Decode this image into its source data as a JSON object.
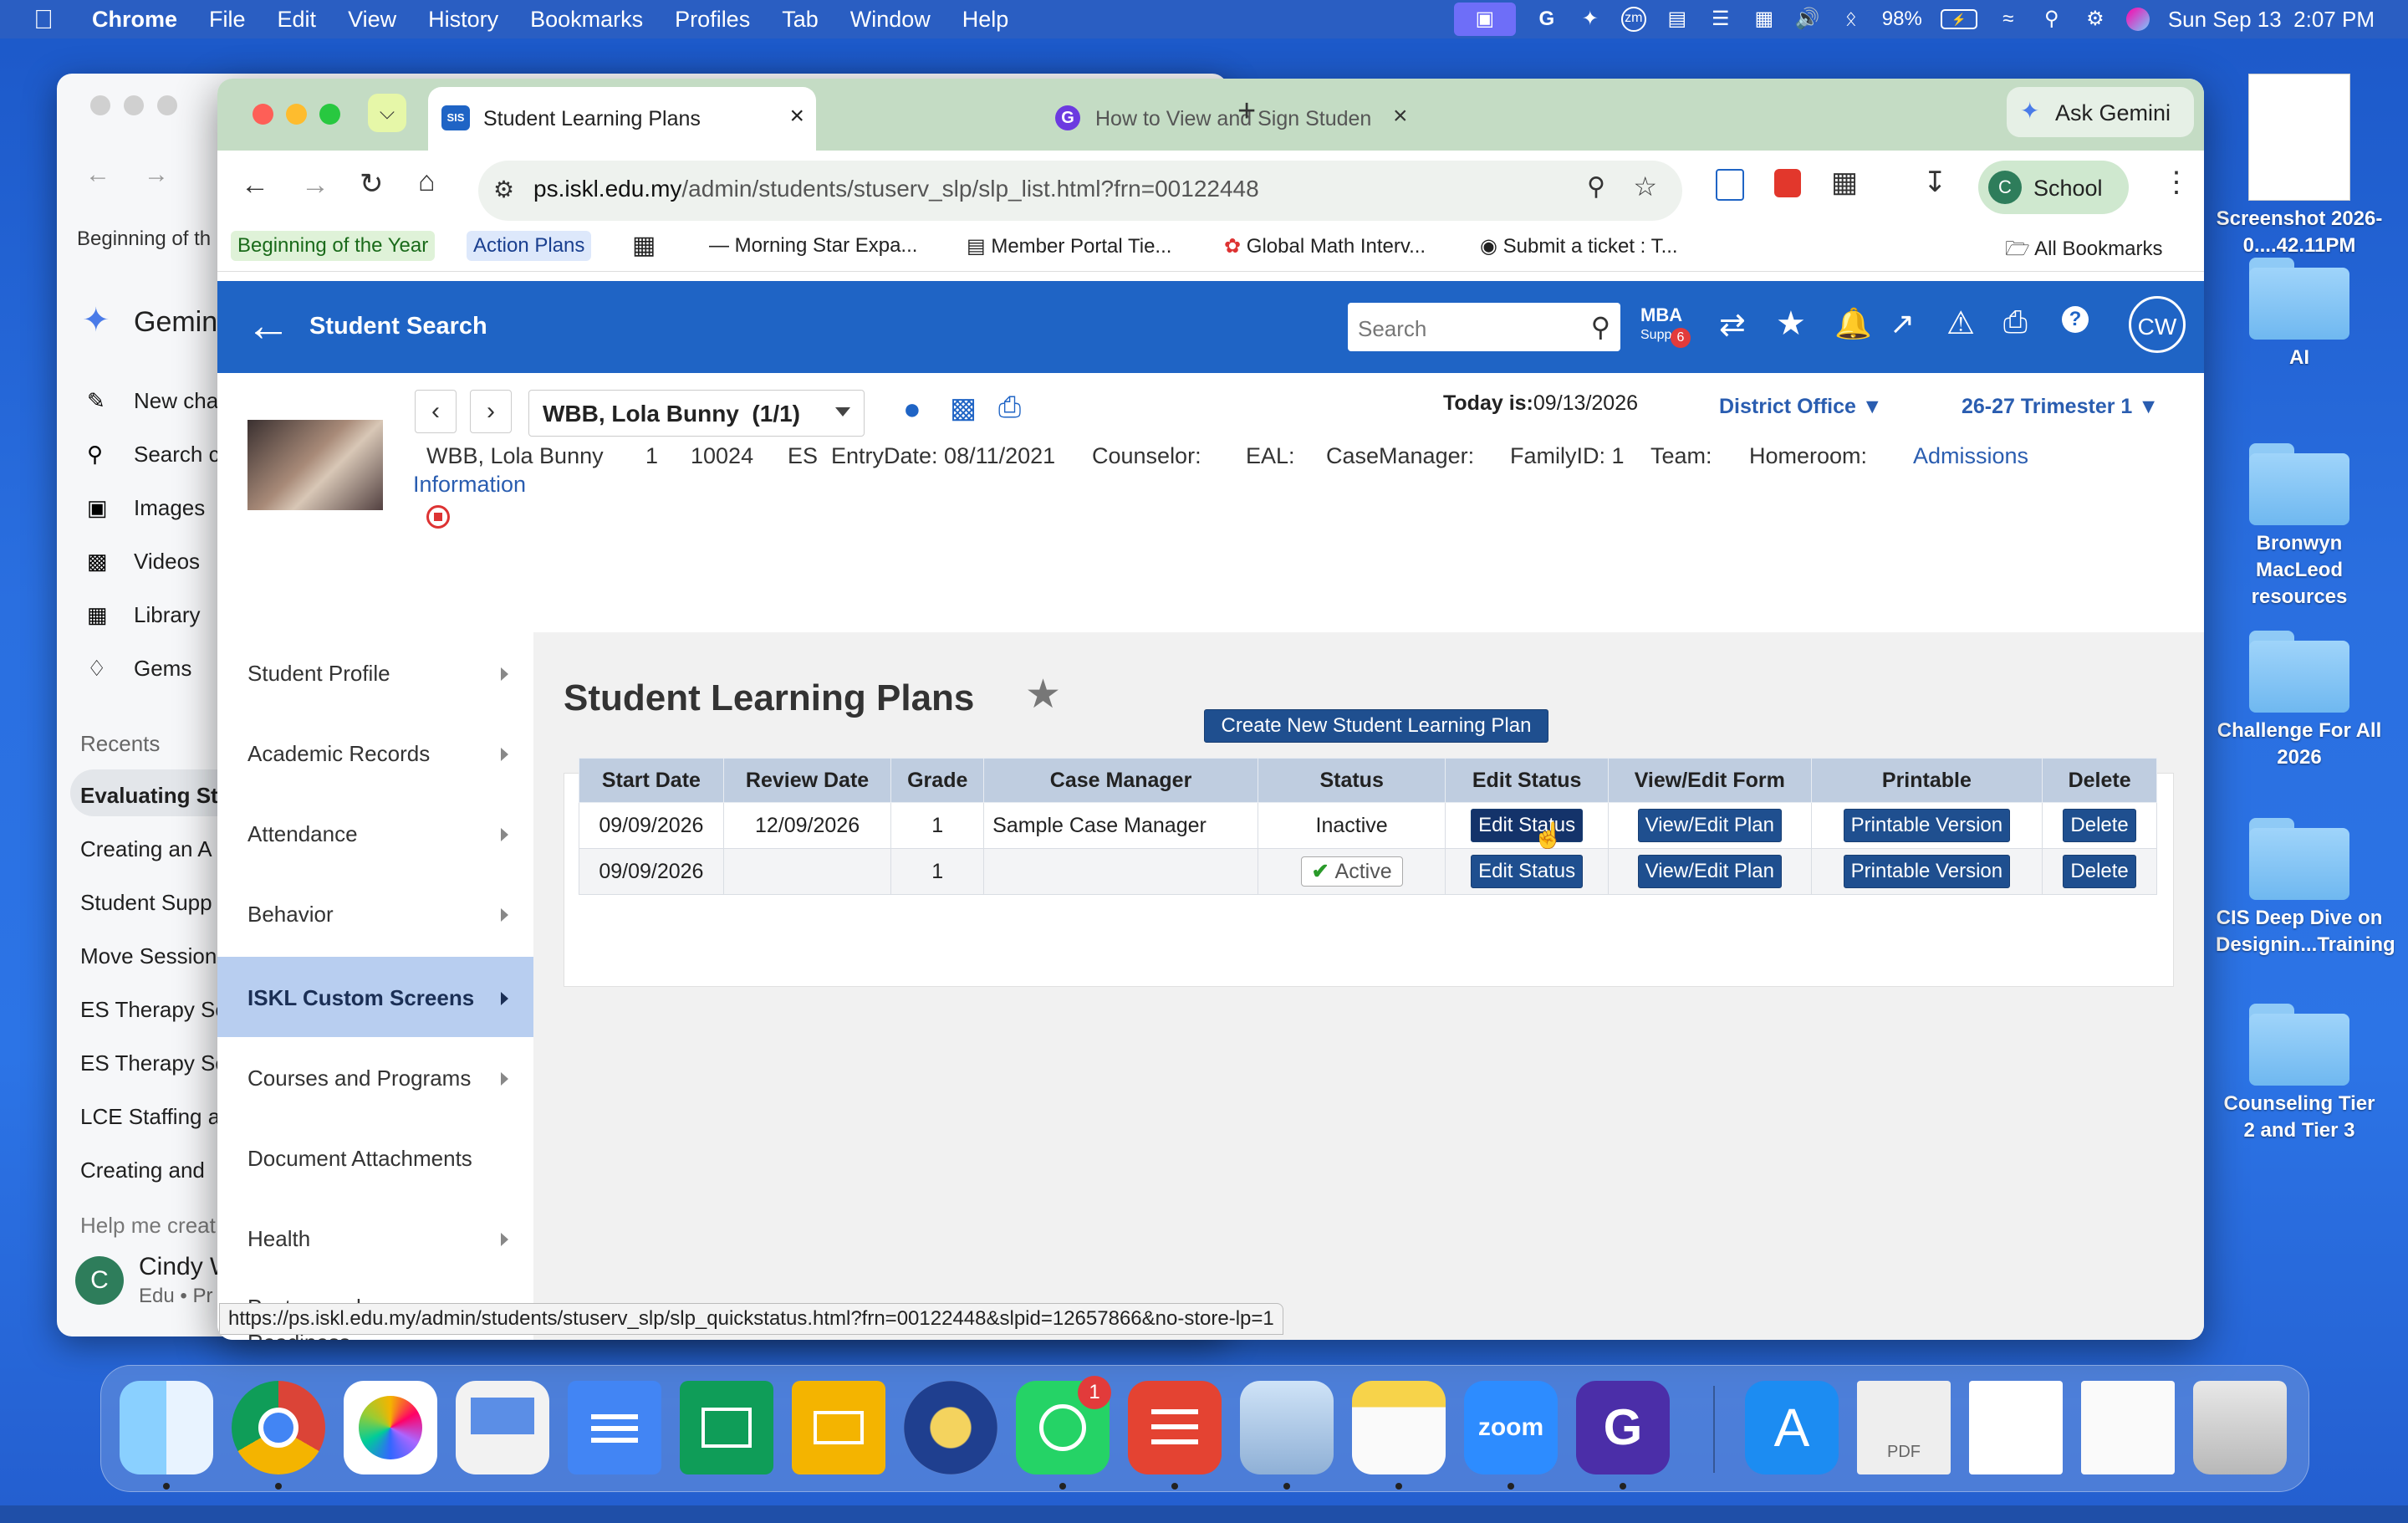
{
  "menubar": {
    "app": "Chrome",
    "menus": [
      "File",
      "Edit",
      "View",
      "History",
      "Bookmarks",
      "Profiles",
      "Tab",
      "Window",
      "Help"
    ],
    "battery": "98%",
    "datetime": "Sun Sep 13  2:07 PM"
  },
  "desktop": {
    "items": [
      {
        "label": "Screenshot 2026-0....42.11PM",
        "type": "file"
      },
      {
        "label": "AI",
        "type": "folder"
      },
      {
        "label": "Bronwyn MacLeod resources",
        "type": "folder"
      },
      {
        "label": "Challenge For All 2026",
        "type": "folder"
      },
      {
        "label": "CIS Deep Dive on Designin...Training",
        "type": "folder"
      },
      {
        "label": "Counseling Tier 2 and Tier 3",
        "type": "folder"
      }
    ]
  },
  "gemini_window": {
    "title": "Gemini",
    "bookmark": "Beginning of th",
    "nav": [
      "New chat",
      "Search c",
      "Images",
      "Videos",
      "Library",
      "Gems"
    ],
    "recents_label": "Recents",
    "recents": [
      "Evaluating St",
      "Creating an A",
      "Student Supp",
      "Move Session",
      "ES Therapy Sc",
      "ES Therapy Sc",
      "LCE Staffing a",
      "Creating and"
    ],
    "help": "Help me creat",
    "user": {
      "initial": "C",
      "name": "Cindy W",
      "sub": "Edu • Pr"
    }
  },
  "browser": {
    "tabs": [
      {
        "title": "Student Learning Plans",
        "active": true
      },
      {
        "title": "How to View and Sign Studen",
        "active": false
      }
    ],
    "ask_gemini": "Ask Gemini",
    "url_host": "ps.iskl.edu.my",
    "url_path": "/admin/students/stuserv_slp/slp_list.html?frn=00122448",
    "profile": {
      "initial": "C",
      "name": "School"
    },
    "bookmarks": [
      "Beginning of the Year",
      "Action Plans",
      "Morning Star Expa...",
      "Member Portal Tie...",
      "Global Math Interv...",
      "Submit a ticket : T..."
    ],
    "all_bookmarks": "All Bookmarks",
    "status_url": "https://ps.iskl.edu.my/admin/students/stuserv_slp/slp_quickstatus.html?frn=00122448&slpid=12657866&no-store-lp=1"
  },
  "app": {
    "back_label": "Student Search",
    "search_placeholder": "Search",
    "mba": "MBA",
    "mba_sub": "Supp",
    "notif_count": "6",
    "avatar": "CW",
    "student_select": "WBB, Lola Bunny  (1/1)",
    "today_label": "Today is:",
    "today": "09/13/2026",
    "school": "District Office",
    "term": "26-27 Trimester 1",
    "student_info": [
      "WBB, Lola Bunny",
      "1",
      "10024",
      "ES",
      "EntryDate: 08/11/2021",
      "Counselor:",
      "EAL:",
      "CaseManager:",
      "FamilyID: 1",
      "Team:",
      "Homeroom:"
    ],
    "admissions_link": "Admissions",
    "information_link": "Information"
  },
  "leftnav": [
    {
      "label": "Student Profile",
      "arrow": true,
      "active": false
    },
    {
      "label": "Academic Records",
      "arrow": true,
      "active": false
    },
    {
      "label": "Attendance",
      "arrow": true,
      "active": false
    },
    {
      "label": "Behavior",
      "arrow": true,
      "active": false
    },
    {
      "label": "ISKL Custom Screens",
      "arrow": true,
      "active": true
    },
    {
      "label": "Courses and Programs",
      "arrow": true,
      "active": false
    },
    {
      "label": "Document Attachments",
      "arrow": false,
      "active": false
    },
    {
      "label": "Health",
      "arrow": true,
      "active": false
    },
    {
      "label": "Postsecondary Readiness",
      "arrow": true,
      "active": false
    }
  ],
  "page": {
    "title": "Student Learning Plans",
    "create_button": "Create New Student Learning Plan",
    "columns": [
      "Start Date",
      "Review Date",
      "Grade",
      "Case Manager",
      "Status",
      "Edit Status",
      "View/Edit Form",
      "Printable",
      "Delete"
    ],
    "rows": [
      {
        "start": "09/09/2026",
        "review": "12/09/2026",
        "grade": "1",
        "manager": "Sample Case Manager",
        "status": "Inactive",
        "edit": "Edit Status",
        "view": "View/Edit Plan",
        "print": "Printable Version",
        "delete": "Delete"
      },
      {
        "start": "09/09/2026",
        "review": "",
        "grade": "1",
        "manager": "",
        "status": "Active",
        "edit": "Edit Status",
        "view": "View/Edit Plan",
        "print": "Printable Version",
        "delete": "Delete"
      }
    ]
  },
  "dock": {
    "apps": [
      "Finder",
      "Google Chrome",
      "Photos",
      "Keynote Presenter",
      "Google Docs",
      "Google Sheets",
      "Google Slides",
      "ISKL",
      "WhatsApp",
      "Todoist",
      "Preview",
      "Notes",
      "Zoom",
      "Grammarly",
      "App Store",
      "PDF",
      "Document",
      "Screenshot",
      "Trash"
    ],
    "whatsapp_badge": "1"
  },
  "colors": {
    "app_bar": "#1f64c5",
    "button": "#1f4f8f",
    "tab_strip": "#c4dcc4",
    "nav_active": "#b8cef0",
    "link": "#2a5db0"
  }
}
